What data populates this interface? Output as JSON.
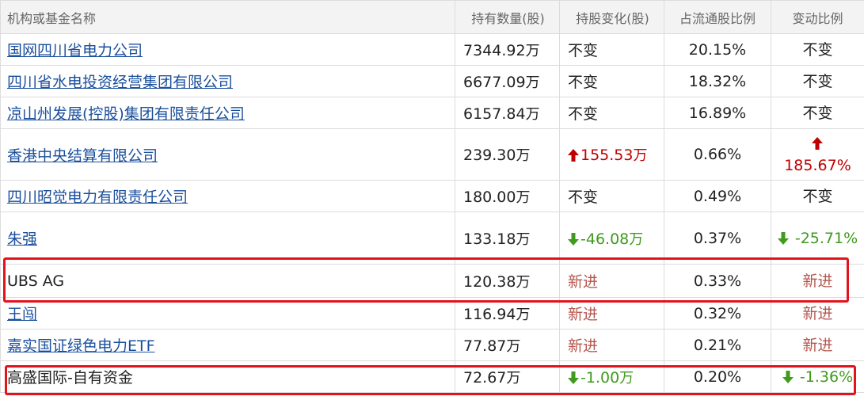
{
  "columns": [
    "机构或基金名称",
    "持有数量(股)",
    "持股变化(股)",
    "占流通股比例",
    "变动比例"
  ],
  "rows": [
    {
      "name": "国网四川省电力公司",
      "link": true,
      "qty": "7344.92",
      "qty_unit": "万",
      "change": "不变",
      "change_dir": "same",
      "change_unit": "",
      "ratio": "20.15%",
      "pct": "不变",
      "pct_dir": "same"
    },
    {
      "name": "四川省水电投资经营集团有限公司",
      "link": true,
      "qty": "6677.09",
      "qty_unit": "万",
      "change": "不变",
      "change_dir": "same",
      "change_unit": "",
      "ratio": "18.32%",
      "pct": "不变",
      "pct_dir": "same"
    },
    {
      "name": "凉山州发展(控股)集团有限责任公司",
      "link": true,
      "qty": "6157.84",
      "qty_unit": "万",
      "change": "不变",
      "change_dir": "same",
      "change_unit": "",
      "ratio": "16.89%",
      "pct": "不变",
      "pct_dir": "same"
    },
    {
      "name": "香港中央结算有限公司",
      "link": true,
      "qty": "239.30",
      "qty_unit": "万",
      "change": "155.53",
      "change_dir": "up",
      "change_unit": "万",
      "ratio": "0.66%",
      "pct": "185.67%",
      "pct_dir": "up"
    },
    {
      "name": "四川昭觉电力有限责任公司",
      "link": true,
      "qty": "180.00",
      "qty_unit": "万",
      "change": "不变",
      "change_dir": "same",
      "change_unit": "",
      "ratio": "0.49%",
      "pct": "不变",
      "pct_dir": "same"
    },
    {
      "name": "朱强",
      "link": true,
      "qty": "133.18",
      "qty_unit": "万",
      "change": "-46.08",
      "change_dir": "down",
      "change_unit": "万",
      "ratio": "0.37%",
      "pct": "-25.71%",
      "pct_dir": "down"
    },
    {
      "name": "UBS AG",
      "link": false,
      "qty": "120.38",
      "qty_unit": "万",
      "change": "新进",
      "change_dir": "new",
      "change_unit": "",
      "ratio": "0.33%",
      "pct": "新进",
      "pct_dir": "new"
    },
    {
      "name": "王闯",
      "link": true,
      "qty": "116.94",
      "qty_unit": "万",
      "change": "新进",
      "change_dir": "new",
      "change_unit": "",
      "ratio": "0.32%",
      "pct": "新进",
      "pct_dir": "new"
    },
    {
      "name": "嘉实国证绿色电力ETF",
      "link": true,
      "qty": "77.87",
      "qty_unit": "万",
      "change": "新进",
      "change_dir": "new",
      "change_unit": "",
      "ratio": "0.21%",
      "pct": "新进",
      "pct_dir": "new"
    },
    {
      "name": "高盛国际-自有资金",
      "link": false,
      "qty": "72.67",
      "qty_unit": "万",
      "change": "-1.00",
      "change_dir": "down",
      "change_unit": "万",
      "ratio": "0.20%",
      "pct": "-1.36%",
      "pct_dir": "down"
    }
  ],
  "highlights": [
    "UBS AG",
    "高盛国际-自有资金"
  ],
  "colors": {
    "link": "#1a4f9c",
    "up": "#c00000",
    "down": "#3f9a1d",
    "new": "#b5574f",
    "highlight": "#e3131c",
    "header_bg": "#f3f3f3"
  }
}
